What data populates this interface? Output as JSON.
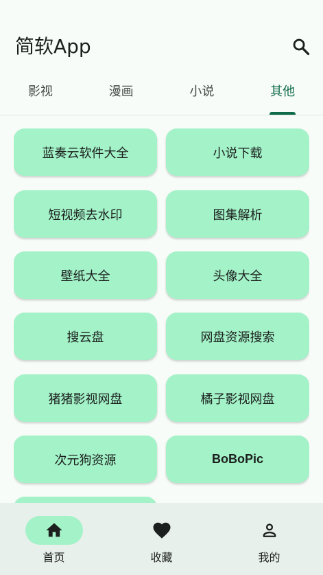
{
  "app": {
    "title": "简软App"
  },
  "tabs": [
    {
      "label": "影视",
      "active": false
    },
    {
      "label": "漫画",
      "active": false
    },
    {
      "label": "小说",
      "active": false
    },
    {
      "label": "其他",
      "active": true
    }
  ],
  "tiles": [
    {
      "label": "蓝奏云软件大全"
    },
    {
      "label": "小说下载"
    },
    {
      "label": "短视频去水印"
    },
    {
      "label": "图集解析"
    },
    {
      "label": "壁纸大全"
    },
    {
      "label": "头像大全"
    },
    {
      "label": "搜云盘"
    },
    {
      "label": "网盘资源搜索"
    },
    {
      "label": "猪猪影视网盘"
    },
    {
      "label": "橘子影视网盘"
    },
    {
      "label": "次元狗资源"
    },
    {
      "label": "BoBoPic"
    },
    {
      "label": ""
    }
  ],
  "bottom_nav": [
    {
      "label": "首页",
      "icon": "home-icon",
      "active": true
    },
    {
      "label": "收藏",
      "icon": "heart-icon",
      "active": false
    },
    {
      "label": "我的",
      "icon": "person-icon",
      "active": false
    }
  ],
  "colors": {
    "background": "#f7fcf8",
    "accent": "#106b4a",
    "tile": "#a3f2c8",
    "nav_background": "#e8f0eb"
  }
}
